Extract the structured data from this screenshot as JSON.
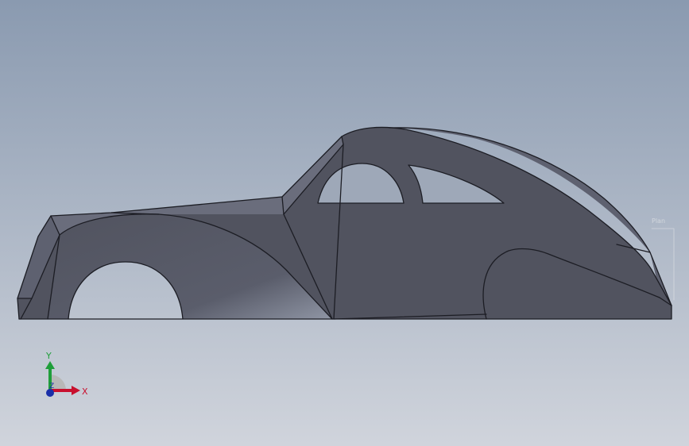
{
  "colors": {
    "background_top": "#8a9ab0",
    "background_bottom": "#d0d4dc",
    "body_fill": "#51535f",
    "body_side_light": "#5e6170",
    "body_roof_light": "#6a6d7c",
    "edge_line": "#1c1d24",
    "window_fill": "#9ea8b8",
    "highlight": "#9aa0ae",
    "axis_x": "#c8102e",
    "axis_y": "#1f9e3a",
    "axis_z": "#1a2fa8",
    "triad_disc": "#b8b8b8",
    "sketch_note": "#f0f0f0"
  },
  "model": {
    "name": "car-body-model",
    "icon": "car-body-3d-model"
  },
  "triad": {
    "x_label": "X",
    "y_label": "Y",
    "z_label": "Z",
    "icon": "reference-triad-icon"
  },
  "sketch_note": {
    "text": "Plan"
  }
}
